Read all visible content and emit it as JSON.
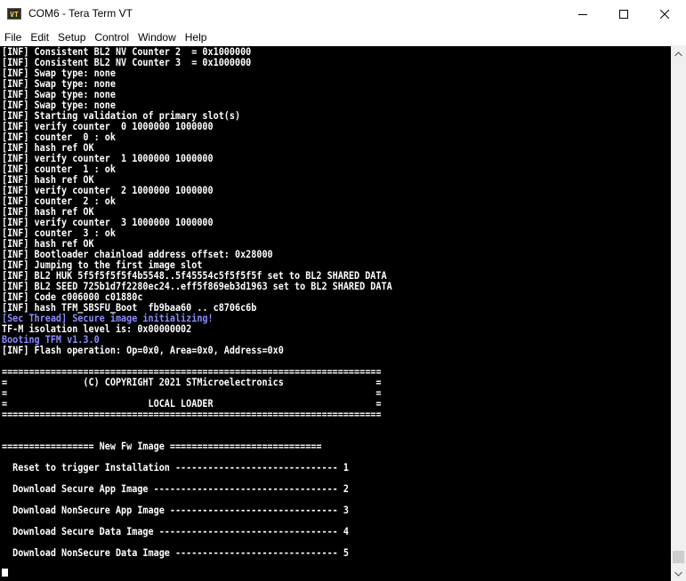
{
  "window": {
    "title": "COM6 - Tera Term VT",
    "icon_label": "VT",
    "controls": {
      "minimize": "—",
      "maximize": "☐",
      "close": "✕"
    }
  },
  "menu": [
    "File",
    "Edit",
    "Setup",
    "Control",
    "Window",
    "Help"
  ],
  "terminal": {
    "lines": [
      {
        "text": "[INF] Consistent BL2 NV Counter 2  = 0x1000000",
        "accent": false
      },
      {
        "text": "[INF] Consistent BL2 NV Counter 3  = 0x1000000",
        "accent": false
      },
      {
        "text": "[INF] Swap type: none",
        "accent": false
      },
      {
        "text": "[INF] Swap type: none",
        "accent": false
      },
      {
        "text": "[INF] Swap type: none",
        "accent": false
      },
      {
        "text": "[INF] Swap type: none",
        "accent": false
      },
      {
        "text": "[INF] Starting validation of primary slot(s)",
        "accent": false
      },
      {
        "text": "[INF] verify counter  0 1000000 1000000",
        "accent": false
      },
      {
        "text": "[INF] counter  0 : ok",
        "accent": false
      },
      {
        "text": "[INF] hash ref OK",
        "accent": false
      },
      {
        "text": "[INF] verify counter  1 1000000 1000000",
        "accent": false
      },
      {
        "text": "[INF] counter  1 : ok",
        "accent": false
      },
      {
        "text": "[INF] hash ref OK",
        "accent": false
      },
      {
        "text": "[INF] verify counter  2 1000000 1000000",
        "accent": false
      },
      {
        "text": "[INF] counter  2 : ok",
        "accent": false
      },
      {
        "text": "[INF] hash ref OK",
        "accent": false
      },
      {
        "text": "[INF] verify counter  3 1000000 1000000",
        "accent": false
      },
      {
        "text": "[INF] counter  3 : ok",
        "accent": false
      },
      {
        "text": "[INF] hash ref OK",
        "accent": false
      },
      {
        "text": "[INF] Bootloader chainload address offset: 0x28000",
        "accent": false
      },
      {
        "text": "[INF] Jumping to the first image slot",
        "accent": false
      },
      {
        "text": "[INF] BL2 HUK 5f5f5f5f5f4b5548..5f45554c5f5f5f5f set to BL2 SHARED DATA",
        "accent": false
      },
      {
        "text": "[INF] BL2 SEED 725b1d7f2280ec24..eff5f869eb3d1963 set to BL2 SHARED DATA",
        "accent": false
      },
      {
        "text": "[INF] Code c006000 c01880c",
        "accent": false
      },
      {
        "text": "[INF] hash TFM_SBSFU_Boot  fb9baa60 .. c8706c6b",
        "accent": false
      },
      {
        "text": "[Sec Thread] Secure image initializing!",
        "accent": true
      },
      {
        "text": "TF-M isolation level is: 0x00000002",
        "accent": false
      },
      {
        "text": "Booting TFM v1.3.0",
        "accent": true
      },
      {
        "text": "[INF] Flash operation: Op=0x0, Area=0x0, Address=0x0",
        "accent": false
      },
      {
        "text": "",
        "accent": false
      },
      {
        "text": "======================================================================",
        "accent": false
      },
      {
        "text": "=              (C) COPYRIGHT 2021 STMicroelectronics                 =",
        "accent": false
      },
      {
        "text": "=                                                                    =",
        "accent": false
      },
      {
        "text": "=                          LOCAL LOADER                              =",
        "accent": false
      },
      {
        "text": "======================================================================",
        "accent": false
      },
      {
        "text": "",
        "accent": false
      },
      {
        "text": "",
        "accent": false
      },
      {
        "text": "================= New Fw Image ============================",
        "accent": false
      },
      {
        "text": "",
        "accent": false
      },
      {
        "text": "  Reset to trigger Installation ------------------------------ 1",
        "accent": false
      },
      {
        "text": "",
        "accent": false
      },
      {
        "text": "  Download Secure App Image ---------------------------------- 2",
        "accent": false
      },
      {
        "text": "",
        "accent": false
      },
      {
        "text": "  Download NonSecure App Image ------------------------------- 3",
        "accent": false
      },
      {
        "text": "",
        "accent": false
      },
      {
        "text": "  Download Secure Data Image --------------------------------- 4",
        "accent": false
      },
      {
        "text": "",
        "accent": false
      },
      {
        "text": "  Download NonSecure Data Image ------------------------------ 5",
        "accent": false
      }
    ]
  },
  "colors": {
    "terminal_bg": "#000000",
    "terminal_fg": "#ffffff",
    "terminal_accent": "#8c8cff"
  }
}
